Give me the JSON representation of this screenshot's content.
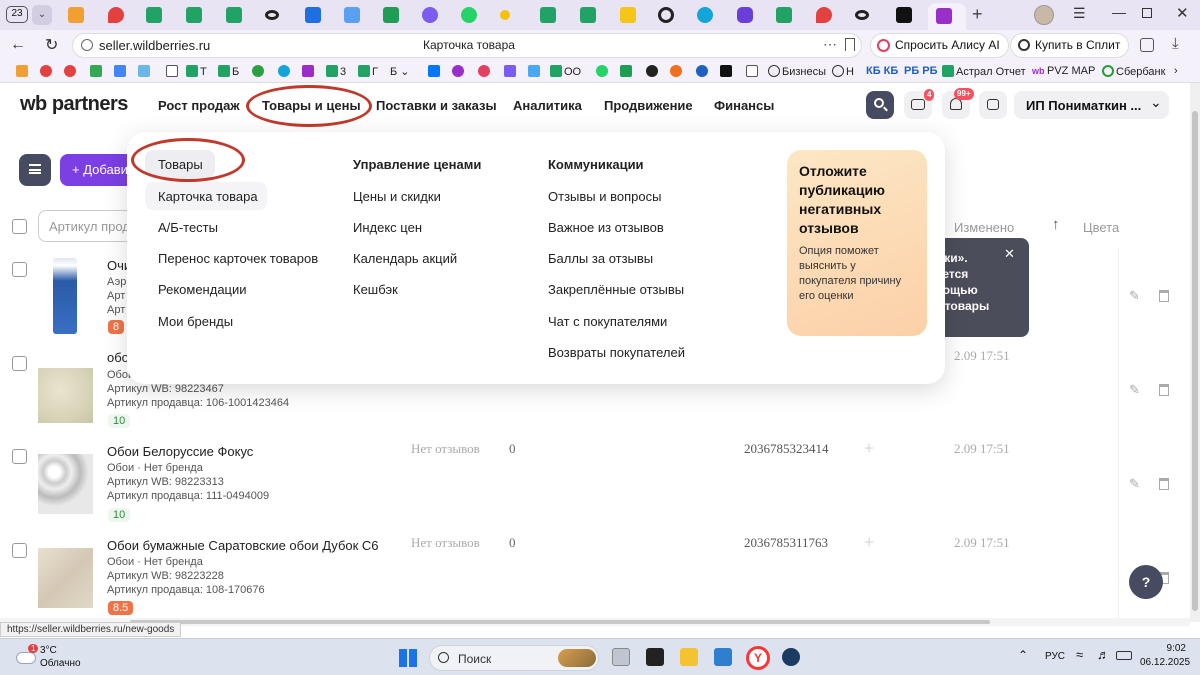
{
  "browser": {
    "tab_count": "23",
    "url": "seller.wildberries.ru",
    "page_title": "Карточка товара",
    "alice_button": "Спросить Алису AI",
    "split_button": "Купить в Сплит",
    "bookmarks": [
      "Т",
      "Б",
      "3",
      "Г",
      "Б",
      "ОО",
      "Бизнесы",
      "Н",
      "КБ КБ",
      "РБ РБ",
      "Астрал Отчет",
      "PVZ MAP",
      "Сбербанк"
    ]
  },
  "header": {
    "logo": "wb partners",
    "nav": [
      "Рост продаж",
      "Товары и цены",
      "Поставки и заказы",
      "Аналитика",
      "Продвижение",
      "Финансы"
    ],
    "chat_badge": "4",
    "bell_badge": "99+",
    "account": "ИП Пониматкин ..."
  },
  "toolbar": {
    "add_label": "Добави"
  },
  "table": {
    "search_placeholder": "Артикул прод",
    "col_changed": "Изменено",
    "col_colors": "Цвета",
    "rows": [
      {
        "title": "Очи",
        "line1": "Аэр",
        "line2": "Арт",
        "line3": "Арт",
        "rating": "8",
        "rating_color": "#f07348"
      },
      {
        "title": "обо",
        "line1": "Обои",
        "line2": "Артикул WB: 98223467",
        "line3": "Артикул продавца: 106-1001423464",
        "rating": "10",
        "rating_color": "#2e8b3e",
        "date": "2.09 17:51"
      },
      {
        "title": "Обои Белоруссие Фокус",
        "line1": "Обои · Нет бренда",
        "line2": "Артикул WB: 98223313",
        "line3": "Артикул продавца: 111-0494009",
        "rating": "10",
        "rating_color": "#2e8b3e",
        "reviews": "Нет отзывов",
        "count": "0",
        "barcode": "2036785323414",
        "date": "2.09 17:51"
      },
      {
        "title": "Обои бумажные Саратовские обои Дубок С6",
        "line1": "Обои · Нет бренда",
        "line2": "Артикул WB: 98223228",
        "line3": "Артикул продавца: 108-170676",
        "rating": "8.5",
        "rating_color": "#f07348",
        "reviews": "Нет отзывов",
        "count": "0",
        "barcode": "2036785311763",
        "date": "2.09 17:51"
      }
    ]
  },
  "tooltip": {
    "lines": [
      "ыки».",
      "жется",
      "мощью",
      "ь товары"
    ]
  },
  "dropdown": {
    "col1": [
      "Товары",
      "Карточка товара",
      "А/Б-тесты",
      "Перенос карточек товаров",
      "Рекомендации",
      "Мои бренды"
    ],
    "col2": [
      "Управление ценами",
      "Цены и скидки",
      "Индекс цен",
      "Календарь акций",
      "Кешбэк"
    ],
    "col3": [
      "Коммуникации",
      "Отзывы и вопросы",
      "Важное из отзывов",
      "Баллы за отзывы",
      "Закреплённые отзывы",
      "Чат с покупателями",
      "Возвраты покупателей"
    ],
    "promo_title": "Отложите публикацию негативных отзывов",
    "promo_text": "Опция поможет выяснить у покупателя причину его оценки"
  },
  "status_url": "https://seller.wildberries.ru/new-goods",
  "taskbar": {
    "weather_temp": "3°C",
    "weather_text": "Облачно",
    "weather_badge": "1",
    "search": "Поиск",
    "lang": "РУС",
    "time": "9:02",
    "date": "06.12.2025"
  },
  "help_button": "?",
  "colors": {
    "accent": "#7b3fe4",
    "annotation": "#c0392b",
    "header_btn": "#474b61"
  }
}
